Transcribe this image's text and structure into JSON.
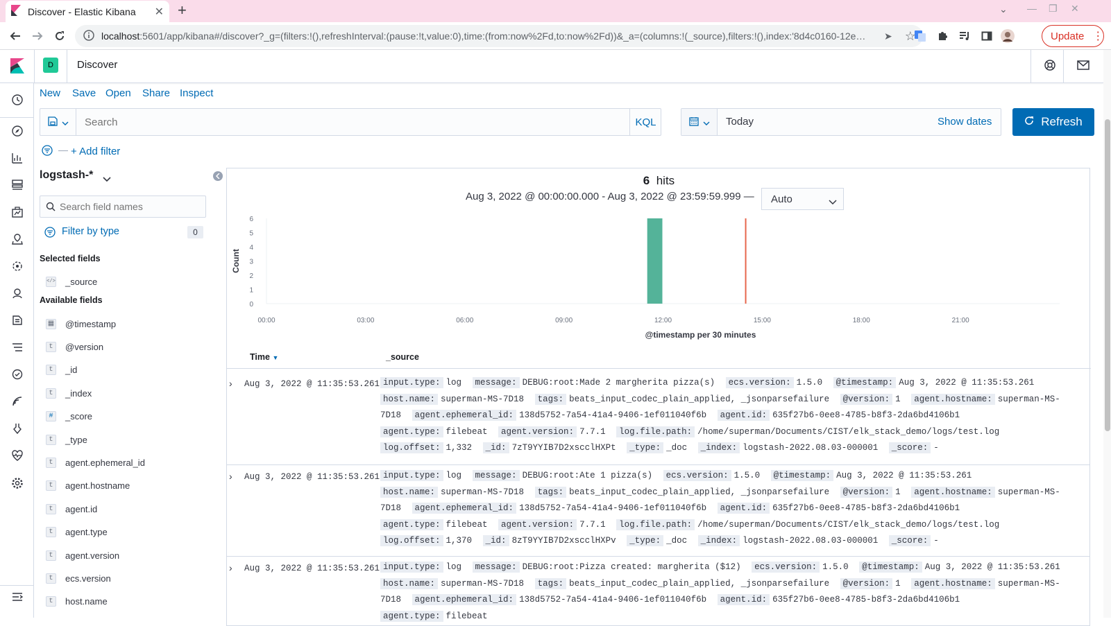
{
  "browser": {
    "tab_title": "Discover - Elastic Kibana",
    "url_host": "localhost",
    "url_rest": ":5601/app/kibana#/discover?_g=(filters:!(),refreshInterval:(pause:!t,value:0),time:(from:now%2Fd,to:now%2Fd))&_a=(columns:!(_source),filters:!(),index:'8d4c0160-12e…",
    "update_label": "Update",
    "colors": {
      "tabbar": "#fadcea",
      "update": "#d93025"
    }
  },
  "kibana": {
    "space_initial": "D",
    "page_title": "Discover",
    "top_links": [
      "New",
      "Save",
      "Open",
      "Share",
      "Inspect"
    ],
    "search_placeholder": "Search",
    "kql_label": "KQL",
    "date_value": "Today",
    "show_dates_label": "Show dates",
    "refresh_label": "Refresh",
    "add_filter_label": "+ Add filter",
    "accent": "#006bb4"
  },
  "sidebar": {
    "index_pattern": "logstash-*",
    "search_fields_placeholder": "Search field names",
    "filter_by_type_label": "Filter by type",
    "filter_count": "0",
    "selected_heading": "Selected fields",
    "selected_fields": [
      {
        "type": "</>",
        "name": "_source"
      }
    ],
    "available_heading": "Available fields",
    "available_fields": [
      {
        "type": "▦",
        "name": "@timestamp"
      },
      {
        "type": "t",
        "name": "@version"
      },
      {
        "type": "t",
        "name": "_id"
      },
      {
        "type": "t",
        "name": "_index"
      },
      {
        "type": "#",
        "name": "_score"
      },
      {
        "type": "t",
        "name": "_type"
      },
      {
        "type": "t",
        "name": "agent.ephemeral_id"
      },
      {
        "type": "t",
        "name": "agent.hostname"
      },
      {
        "type": "t",
        "name": "agent.id"
      },
      {
        "type": "t",
        "name": "agent.type"
      },
      {
        "type": "t",
        "name": "agent.version"
      },
      {
        "type": "t",
        "name": "ecs.version"
      },
      {
        "type": "t",
        "name": "host.name"
      }
    ]
  },
  "hits": {
    "count": "6",
    "label": "hits",
    "range_text": "Aug 3, 2022 @ 00:00:00.000 - Aug 3, 2022 @ 23:59:59.999 —",
    "interval_value": "Auto"
  },
  "chart_data": {
    "type": "bar",
    "ylabel": "Count",
    "xlabel": "@timestamp per 30 minutes",
    "x_ticks": [
      "00:00",
      "03:00",
      "06:00",
      "09:00",
      "12:00",
      "15:00",
      "18:00",
      "21:00"
    ],
    "y_ticks": [
      0,
      1,
      2,
      3,
      4,
      5,
      6
    ],
    "ylim": [
      0,
      6
    ],
    "x_range_hours": [
      0,
      24
    ],
    "bars": [
      {
        "start_hour": 11.5,
        "end_hour": 12.0,
        "value": 6
      }
    ],
    "now_marker_hour": 14.5,
    "bar_color": "#54b399",
    "marker_color": "#e7664c",
    "grid": false
  },
  "table": {
    "columns": [
      "Time",
      "_source"
    ],
    "rows": [
      {
        "time": "Aug 3, 2022 @ 11:35:53.261",
        "fields": [
          [
            "input.type:",
            "log"
          ],
          [
            "message:",
            "DEBUG:root:Made 2 margherita pizza(s)"
          ],
          [
            "ecs.version:",
            "1.5.0"
          ],
          [
            "@timestamp:",
            "Aug 3, 2022 @ 11:35:53.261"
          ],
          [
            "host.name:",
            "superman-MS-7D18"
          ],
          [
            "tags:",
            "beats_input_codec_plain_applied, _jsonparsefailure"
          ],
          [
            "@version:",
            "1"
          ],
          [
            "agent.hostname:",
            "superman-MS-7D18"
          ],
          [
            "agent.ephemeral_id:",
            "138d5752-7a54-41a4-9406-1ef011040f6b"
          ],
          [
            "agent.id:",
            "635f27b6-0ee8-4785-b8f3-2da6bd4106b1"
          ],
          [
            "agent.type:",
            "filebeat"
          ],
          [
            "agent.version:",
            "7.7.1"
          ],
          [
            "log.file.path:",
            "/home/superman/Documents/CIST/elk_stack_demo/logs/test.log"
          ],
          [
            "log.offset:",
            "1,332"
          ],
          [
            "_id:",
            "7zT9YYIB7D2xscclHXPt"
          ],
          [
            "_type:",
            "_doc"
          ],
          [
            "_index:",
            "logstash-2022.08.03-000001"
          ],
          [
            "_score:",
            "-"
          ]
        ]
      },
      {
        "time": "Aug 3, 2022 @ 11:35:53.261",
        "fields": [
          [
            "input.type:",
            "log"
          ],
          [
            "message:",
            "DEBUG:root:Ate 1 pizza(s)"
          ],
          [
            "ecs.version:",
            "1.5.0"
          ],
          [
            "@timestamp:",
            "Aug 3, 2022 @ 11:35:53.261"
          ],
          [
            "host.name:",
            "superman-MS-7D18"
          ],
          [
            "tags:",
            "beats_input_codec_plain_applied, _jsonparsefailure"
          ],
          [
            "@version:",
            "1"
          ],
          [
            "agent.hostname:",
            "superman-MS-7D18"
          ],
          [
            "agent.ephemeral_id:",
            "138d5752-7a54-41a4-9406-1ef011040f6b"
          ],
          [
            "agent.id:",
            "635f27b6-0ee8-4785-b8f3-2da6bd4106b1"
          ],
          [
            "agent.type:",
            "filebeat"
          ],
          [
            "agent.version:",
            "7.7.1"
          ],
          [
            "log.file.path:",
            "/home/superman/Documents/CIST/elk_stack_demo/logs/test.log"
          ],
          [
            "log.offset:",
            "1,370"
          ],
          [
            "_id:",
            "8zT9YYIB7D2xscclHXPv"
          ],
          [
            "_type:",
            "_doc"
          ],
          [
            "_index:",
            "logstash-2022.08.03-000001"
          ],
          [
            "_score:",
            "-"
          ]
        ]
      },
      {
        "time": "Aug 3, 2022 @ 11:35:53.261",
        "fields": [
          [
            "input.type:",
            "log"
          ],
          [
            "message:",
            "DEBUG:root:Pizza created: margherita ($12)"
          ],
          [
            "ecs.version:",
            "1.5.0"
          ],
          [
            "@timestamp:",
            "Aug 3, 2022 @ 11:35:53.261"
          ],
          [
            "host.name:",
            "superman-MS-7D18"
          ],
          [
            "tags:",
            "beats_input_codec_plain_applied, _jsonparsefailure"
          ],
          [
            "@version:",
            "1"
          ],
          [
            "agent.hostname:",
            "superman-MS-7D18"
          ],
          [
            "agent.ephemeral_id:",
            "138d5752-7a54-41a4-9406-1ef011040f6b"
          ],
          [
            "agent.id:",
            "635f27b6-0ee8-4785-b8f3-2da6bd4106b1"
          ],
          [
            "agent.type:",
            "filebeat"
          ]
        ]
      }
    ]
  }
}
